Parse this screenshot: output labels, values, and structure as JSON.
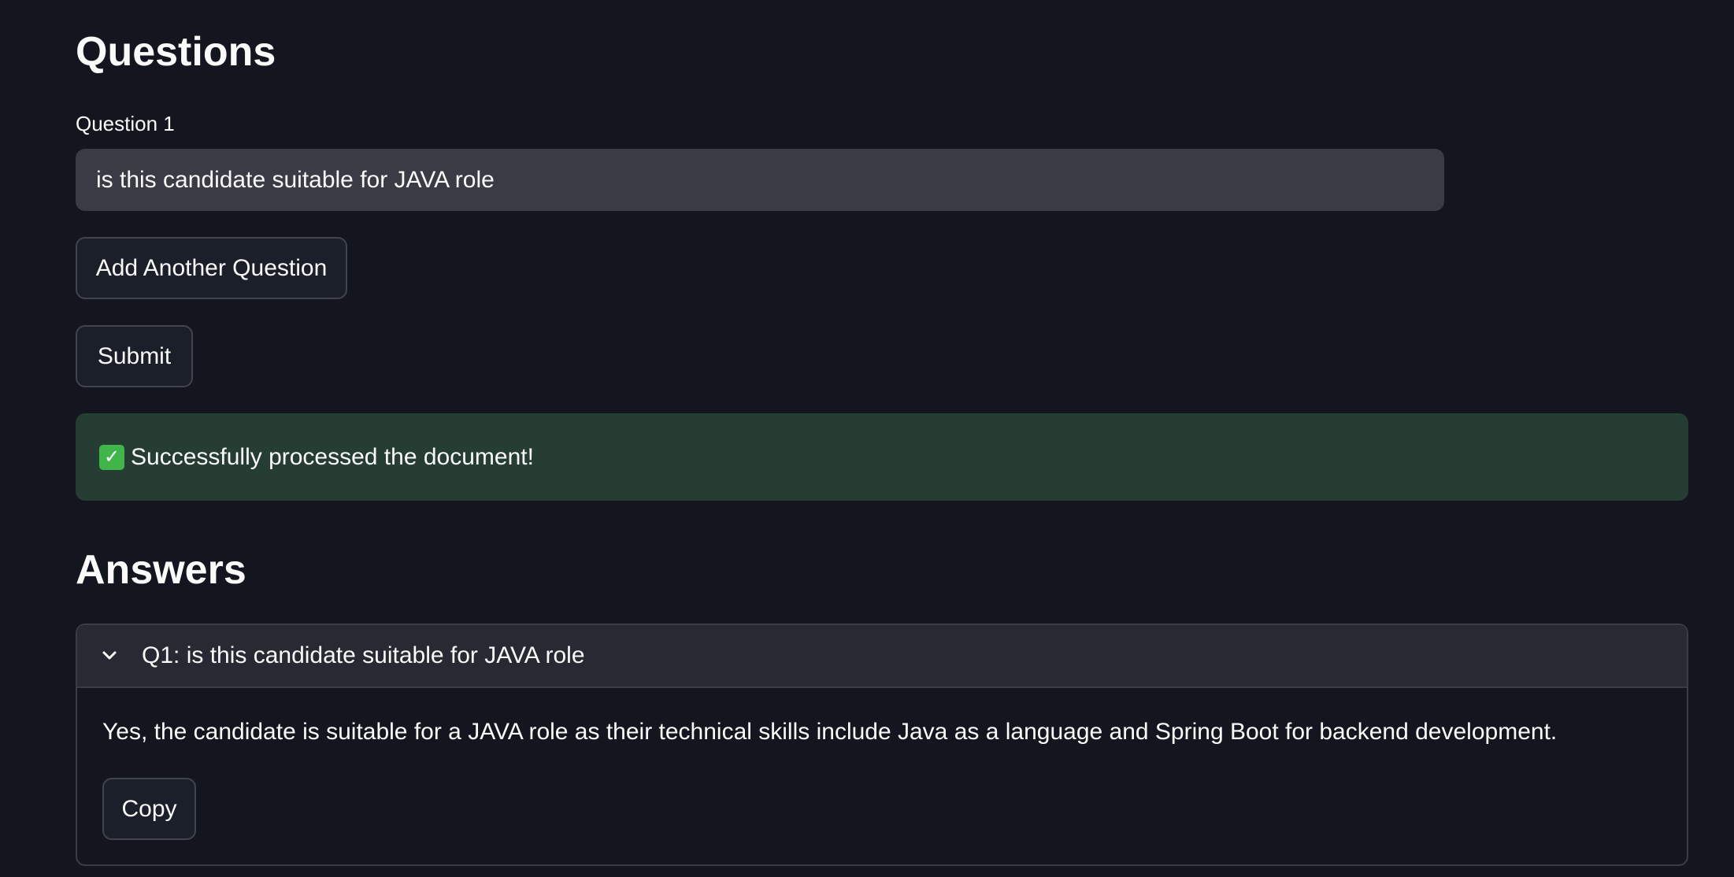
{
  "questions": {
    "heading": "Questions",
    "field_label": "Question 1",
    "field_value": "is this candidate suitable for JAVA role",
    "add_button_label": "Add Another Question",
    "submit_button_label": "Submit"
  },
  "status": {
    "icon": "check-mark-icon",
    "message": "Successfully processed the document!",
    "color": "#263d33"
  },
  "answers": {
    "heading": "Answers",
    "items": [
      {
        "title": "Q1: is this candidate suitable for JAVA role",
        "answer": "Yes, the candidate is suitable for a JAVA role as their technical skills include Java as a language and Spring Boot for backend development.",
        "copy_label": "Copy"
      }
    ]
  },
  "theme": {
    "background": "#14161f",
    "input_background": "#3a3b44",
    "button_background": "#1b1f2a",
    "success_background": "#263d33"
  }
}
